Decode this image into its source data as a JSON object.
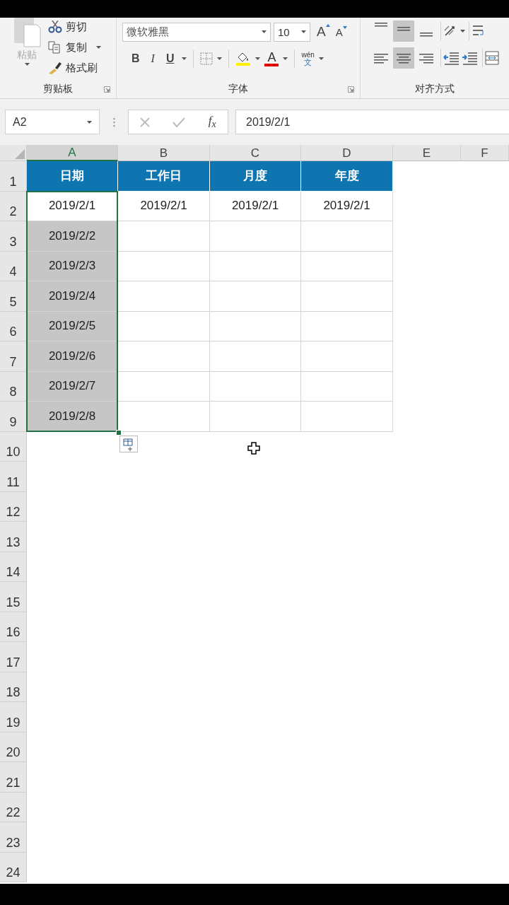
{
  "ribbon": {
    "groups": [
      {
        "kind": "clipboard",
        "label": "剪贴板",
        "paste": {
          "label": "粘贴",
          "disabled": true
        },
        "items": [
          {
            "label": "剪切",
            "dropdown": false
          },
          {
            "label": "复制",
            "dropdown": true
          },
          {
            "label": "格式刷",
            "dropdown": false
          }
        ]
      },
      {
        "kind": "font",
        "label": "字体",
        "font_name": "微软雅黑",
        "font_size": "10",
        "grow": "A",
        "shrink": "A",
        "bold": "B",
        "italic": "I",
        "underline": "U",
        "font_color": "A",
        "phonetic": [
          "wén",
          "文"
        ]
      },
      {
        "kind": "alignment",
        "label": "对齐方式",
        "vertical": [
          {
            "selected": false
          },
          {
            "selected": true
          },
          {
            "selected": false
          }
        ],
        "horizontal": [
          {
            "selected": false
          },
          {
            "selected": true
          },
          {
            "selected": false
          }
        ]
      }
    ]
  },
  "formula_bar": {
    "name_box": "A2",
    "function_label": "f$_{x}$",
    "value": "2019/2/1"
  },
  "sheet": {
    "columns": [
      {
        "label": "A",
        "selected": true
      },
      {
        "label": "B",
        "selected": false
      },
      {
        "label": "C",
        "selected": false
      },
      {
        "label": "D",
        "selected": false
      },
      {
        "label": "E",
        "selected": false
      },
      {
        "label": "F",
        "selected": false
      }
    ],
    "row_numbers": [
      "1",
      "2",
      "3",
      "4",
      "5",
      "6",
      "7",
      "8",
      "9",
      "10",
      "11",
      "12",
      "13",
      "14",
      "15",
      "16",
      "17",
      "18",
      "19",
      "20",
      "21",
      "22",
      "23",
      "24"
    ],
    "table": {
      "rows": [
        {
          "kind": "header",
          "cells": [
            {
              "text": "日期",
              "selected": false
            },
            {
              "text": "工作日",
              "selected": false
            },
            {
              "text": "月度",
              "selected": false
            },
            {
              "text": "年度",
              "selected": false
            }
          ]
        },
        {
          "kind": "data",
          "cells": [
            {
              "text": "2019/2/1",
              "selected": true,
              "active": true
            },
            {
              "text": "2019/2/1",
              "selected": false
            },
            {
              "text": "2019/2/1",
              "selected": false
            },
            {
              "text": "2019/2/1",
              "selected": false
            }
          ]
        },
        {
          "kind": "data",
          "cells": [
            {
              "text": "2019/2/2",
              "selected": true,
              "active": false
            }
          ]
        },
        {
          "kind": "data",
          "cells": [
            {
              "text": "2019/2/3",
              "selected": true,
              "active": false
            }
          ]
        },
        {
          "kind": "data",
          "cells": [
            {
              "text": "2019/2/4",
              "selected": true,
              "active": false
            }
          ]
        },
        {
          "kind": "data",
          "cells": [
            {
              "text": "2019/2/5",
              "selected": true,
              "active": false
            }
          ]
        },
        {
          "kind": "data",
          "cells": [
            {
              "text": "2019/2/6",
              "selected": true,
              "active": false
            }
          ]
        },
        {
          "kind": "data",
          "cells": [
            {
              "text": "2019/2/7",
              "selected": true,
              "active": false
            }
          ]
        },
        {
          "kind": "data",
          "cells": [
            {
              "text": "2019/2/8",
              "selected": true,
              "active": false
            }
          ]
        }
      ]
    }
  }
}
